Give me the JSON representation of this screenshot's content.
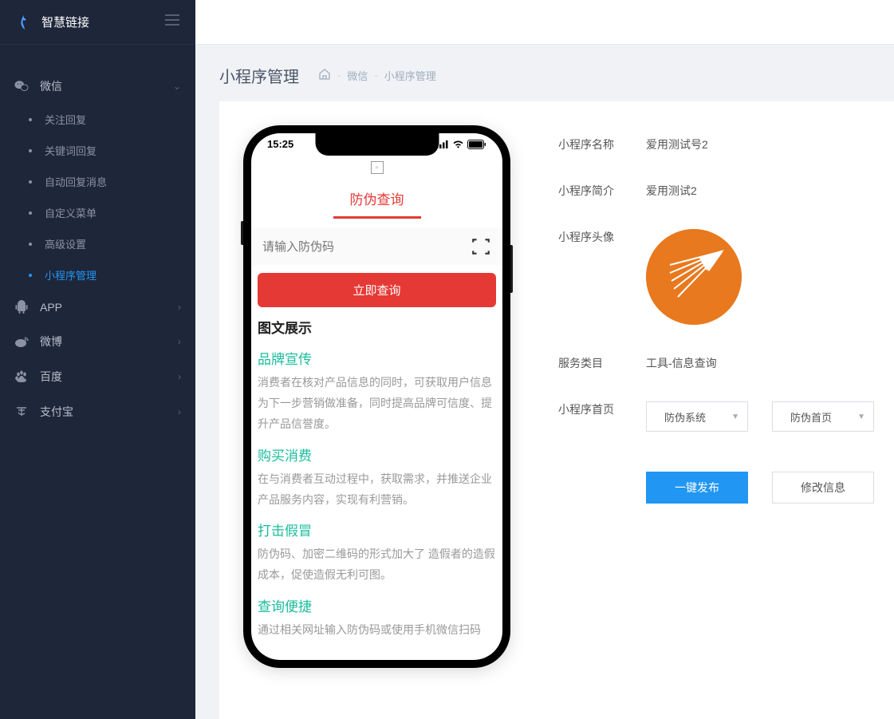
{
  "brand": "智慧链接",
  "sidebar": {
    "wechat": {
      "label": "微信"
    },
    "subs": [
      {
        "label": "关注回复"
      },
      {
        "label": "关键词回复"
      },
      {
        "label": "自动回复消息"
      },
      {
        "label": "自定义菜单"
      },
      {
        "label": "高级设置"
      },
      {
        "label": "小程序管理"
      }
    ],
    "app": {
      "label": "APP"
    },
    "weibo": {
      "label": "微博"
    },
    "baidu": {
      "label": "百度"
    },
    "alipay": {
      "label": "支付宝"
    }
  },
  "page": {
    "title": "小程序管理",
    "crumb1": "微信",
    "crumb2": "小程序管理"
  },
  "phone": {
    "time": "15:25",
    "tab_title": "防伪查询",
    "input_placeholder": "请输入防伪码",
    "query_btn": "立即查询",
    "section_head": "图文展示",
    "blocks": [
      {
        "title": "品牌宣传",
        "text": "消费者在核对产品信息的同时，可获取用户信息为下一步营销做准备，同时提高品牌可信度、提升产品信誉度。"
      },
      {
        "title": "购买消费",
        "text": "在与消费者互动过程中，获取需求，并推送企业产品服务内容，实现有利营销。"
      },
      {
        "title": "打击假冒",
        "text": "防伪码、加密二维码的形式加大了 造假者的造假成本，促使造假无利可图。"
      },
      {
        "title": "查询便捷",
        "text": "通过相关网址输入防伪码或使用手机微信扫码"
      }
    ]
  },
  "form": {
    "name_label": "小程序名称",
    "name_value": "爱用测试号2",
    "intro_label": "小程序简介",
    "intro_value": "爱用测试2",
    "avatar_label": "小程序头像",
    "category_label": "服务类目",
    "category_value": "工具-信息查询",
    "home_label": "小程序首页",
    "select1": "防伪系统",
    "select2": "防伪首页",
    "btn_publish": "一键发布",
    "btn_edit": "修改信息"
  }
}
